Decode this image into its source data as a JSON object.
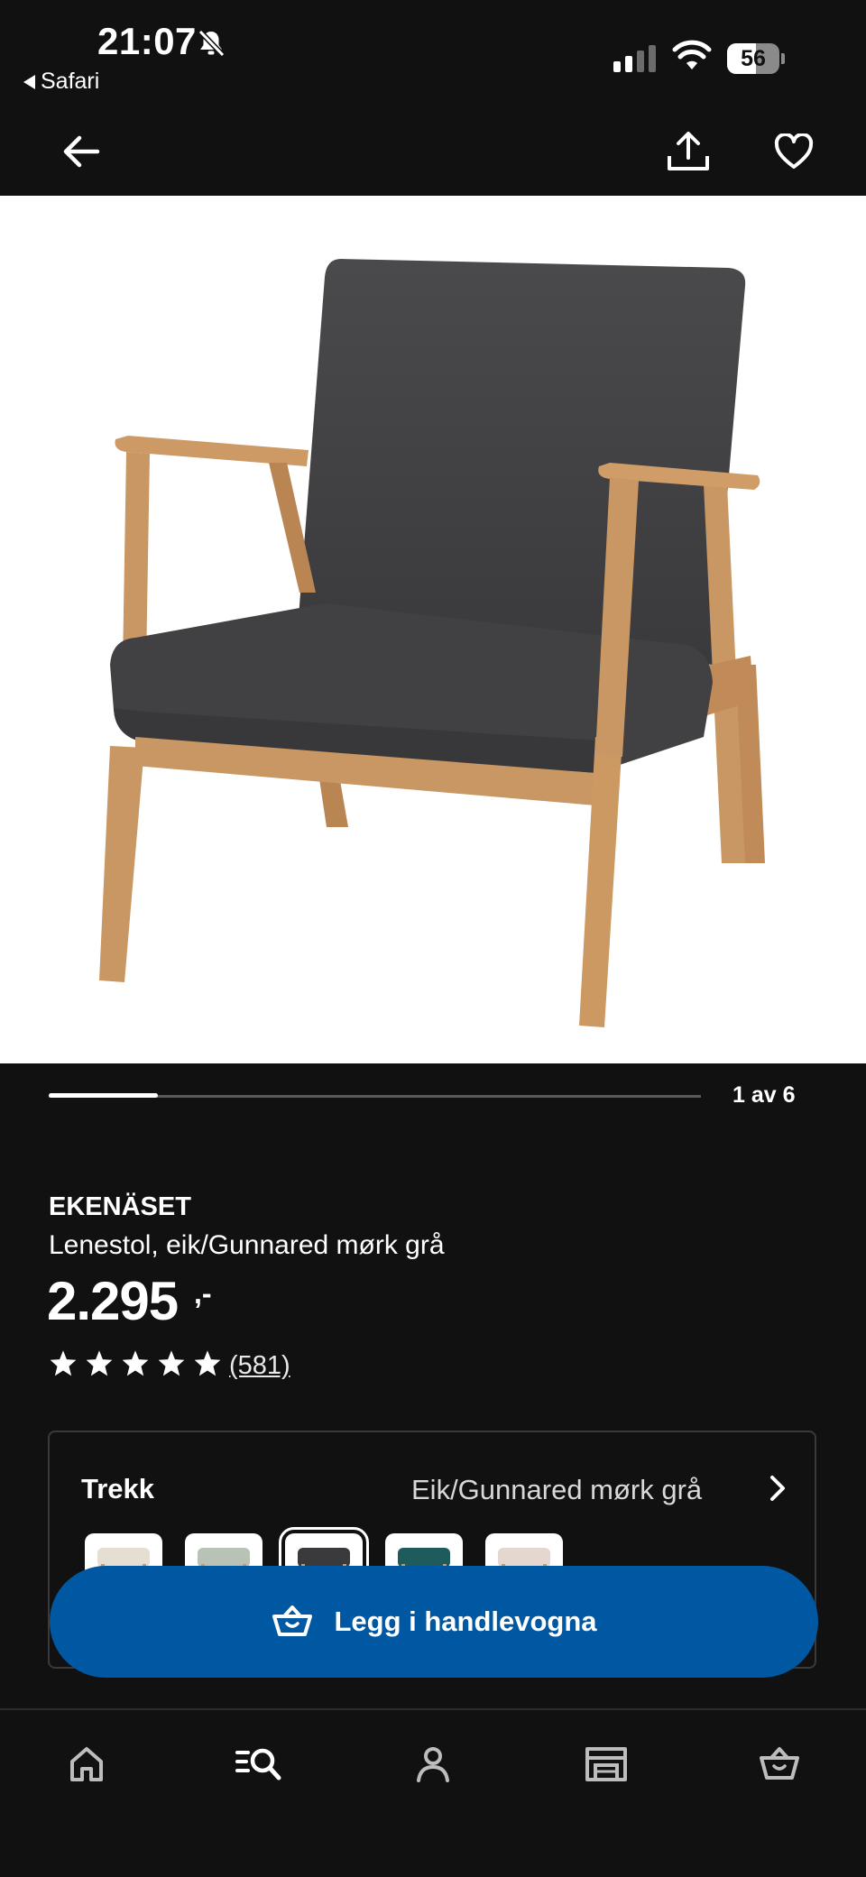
{
  "status_bar": {
    "time": "21:07",
    "back_app": "Safari",
    "battery": "56",
    "battery_percent": 56,
    "signal_bars_active": 2,
    "signal_bars_total": 4,
    "icons": [
      "bell-slash-icon",
      "signal-icon",
      "wifi-icon",
      "battery-icon"
    ]
  },
  "nav": {
    "icons": [
      "back-arrow-icon",
      "share-icon",
      "heart-icon"
    ]
  },
  "gallery": {
    "count_label": "1 av 6",
    "current": 1,
    "total": 6
  },
  "product": {
    "name": "EKENÄSET",
    "description": "Lenestol, eik/Gunnared mørk grå",
    "price": "2.295",
    "price_suffix": ",-",
    "rating_stars": 5,
    "reviews": "(581)"
  },
  "variant": {
    "label": "Trekk",
    "value": "Eik/Gunnared mørk grå",
    "selected_index": 2,
    "swatches": [
      {
        "color": "#e4dfd2"
      },
      {
        "color": "#b8c2b5"
      },
      {
        "color": "#3a3a3c"
      },
      {
        "color": "#1f5a5c"
      },
      {
        "color": "#e6d6d0"
      }
    ]
  },
  "cart_button": {
    "label": "Legg i handlevogna",
    "color": "#0058a3"
  },
  "tab_bar": {
    "icons": [
      "home-icon",
      "search-list-icon",
      "profile-icon",
      "store-icon",
      "cart-basket-icon"
    ]
  },
  "colors": {
    "background": "#111111",
    "accent": "#0058a3",
    "chair_fabric": "#434345",
    "chair_wood": "#c8935f"
  }
}
